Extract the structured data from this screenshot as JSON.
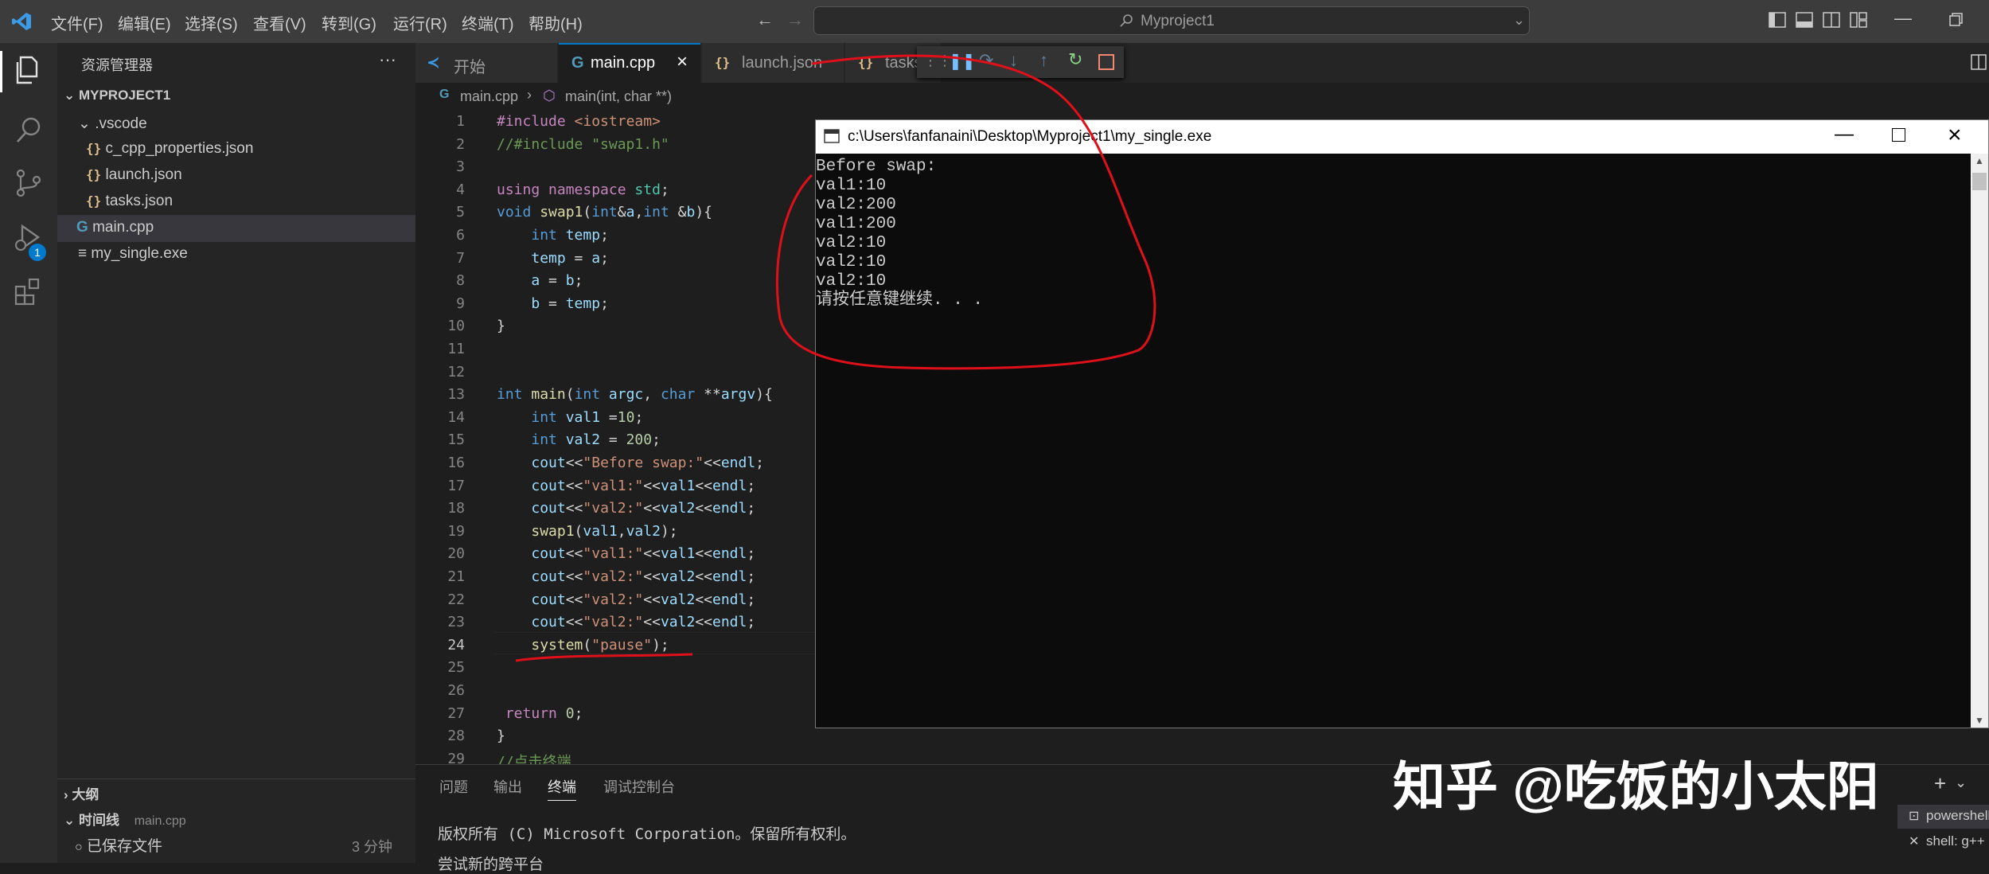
{
  "menu": [
    "文件(F)",
    "编辑(E)",
    "选择(S)",
    "查看(V)",
    "转到(G)",
    "运行(R)",
    "终端(T)",
    "帮助(H)"
  ],
  "search": {
    "text": "Myproject1"
  },
  "sidebar": {
    "title": "资源管理器",
    "more": "···",
    "project": "MYPROJECT1",
    "vscode_folder": ".vscode",
    "items": [
      "c_cpp_properties.json",
      "launch.json",
      "tasks.json",
      "main.cpp",
      "my_single.exe"
    ],
    "outline": "大纲",
    "timeline": "时间线",
    "timeline_file": "main.cpp",
    "timeline_entry": "已保存文件",
    "timeline_time": "3 分钟"
  },
  "debug_badge": "1",
  "tabs": [
    "开始",
    "main.cpp",
    "launch.json",
    "tasks.json"
  ],
  "tab_close": "×",
  "breadcrumb": {
    "file": "main.cpp",
    "symbol": "main(int, char **)"
  },
  "code": {
    "line_numbers": [
      "1",
      "2",
      "3",
      "4",
      "5",
      "6",
      "7",
      "8",
      "9",
      "10",
      "11",
      "12",
      "13",
      "14",
      "15",
      "16",
      "17",
      "18",
      "19",
      "20",
      "21",
      "22",
      "23",
      "24",
      "25",
      "26",
      "27",
      "28",
      "29"
    ],
    "lines": [
      "#include <iostream>",
      "//#include \"swap1.h\"",
      "",
      "using namespace std;",
      "void swap1(int&a,int &b){",
      "    int temp;",
      "    temp = a;",
      "    a = b;",
      "    b = temp;",
      "}",
      "",
      "",
      "int main(int argc, char **argv){",
      "    int val1 =10;",
      "    int val2 = 200;",
      "    cout<<\"Before swap:\"<<endl;",
      "    cout<<\"val1:\"<<val1<<endl;",
      "    cout<<\"val2:\"<<val2<<endl;",
      "    swap1(val1,val2);",
      "    cout<<\"val1:\"<<val1<<endl;",
      "    cout<<\"val2:\"<<val2<<endl;",
      "    cout<<\"val2:\"<<val2<<endl;",
      "    cout<<\"val2:\"<<val2<<endl;",
      "    system(\"pause\");",
      "",
      "",
      " return 0;",
      "}",
      "//点击终端"
    ]
  },
  "console": {
    "title": "c:\\Users\\fanfanaini\\Desktop\\Myproject1\\my_single.exe",
    "output": [
      "Before swap:",
      "val1:10",
      "val2:200",
      "val1:200",
      "val2:10",
      "val2:10",
      "val2:10",
      "请按任意键继续. . ."
    ]
  },
  "panel": {
    "tabs": [
      "问题",
      "输出",
      "终端",
      "调试控制台"
    ],
    "line1": "版权所有 (C) Microsoft Corporation。保留所有权利。",
    "line2": "尝试新的跨平台",
    "terminals": [
      "powershell",
      "shell: g++"
    ],
    "add": "+"
  },
  "watermark": "知乎 @吃饭的小太阳",
  "colors": {
    "accent": "#007acc",
    "annotation": "#e0101a",
    "titlebar": "#3c3c3c"
  }
}
